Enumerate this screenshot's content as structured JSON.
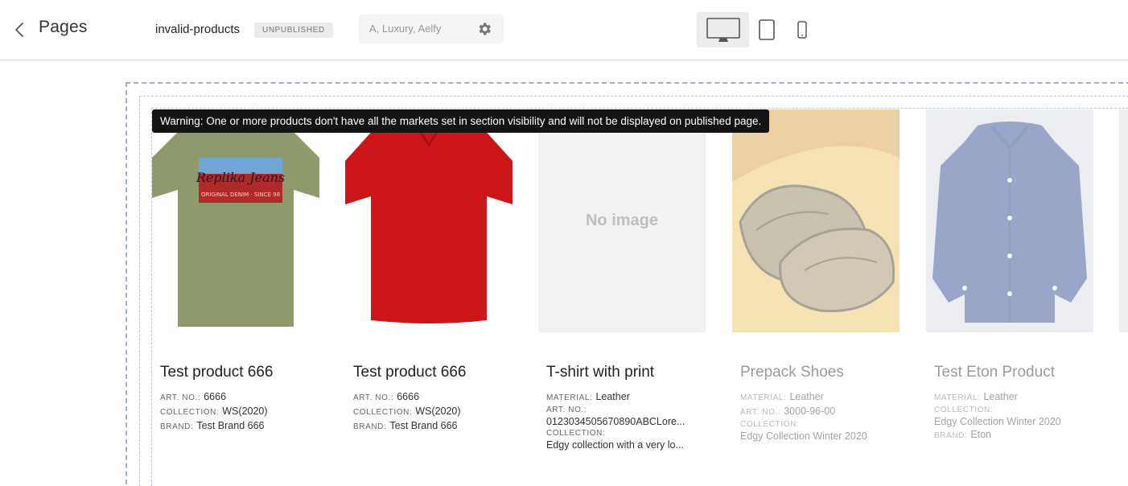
{
  "header": {
    "back_label": "Pages",
    "page_name": "invalid-products",
    "status_badge": "UNPUBLISHED",
    "markets_text": "A, Luxury, Aelfy"
  },
  "devices": [
    "desktop-icon",
    "tablet-icon",
    "mobile-icon"
  ],
  "selected_device": "desktop",
  "warning": "Warning: One or more products don't have all the markets set in section visibility and will not be displayed on published page.",
  "products": [
    {
      "name": "Test product 666",
      "image": "olive-tshirt",
      "art_label": "ART. NO.:",
      "art_value": "6666",
      "collection_label": "COLLECTION:",
      "collection_value": "WS(2020)",
      "brand_label": "BRAND:",
      "brand_value": "Test Brand 666"
    },
    {
      "name": "Test product 666",
      "image": "red-tshirt",
      "art_label": "ART. NO.:",
      "art_value": "6666",
      "collection_label": "COLLECTION:",
      "collection_value": "WS(2020)",
      "brand_label": "BRAND:",
      "brand_value": "Test Brand 666"
    },
    {
      "name": "T-shirt with print",
      "image_placeholder": "No image",
      "material_label": "MATERIAL:",
      "material_value": "Leather",
      "art_label": "ART. NO.:",
      "art_value": "0123034505670890ABCLore...",
      "collection_label": "COLLECTION:",
      "collection_value": "Edgy collection with a very lo..."
    },
    {
      "name": "Prepack Shoes",
      "image": "painted-shoes",
      "material_label": "MATERIAL:",
      "material_value": "Leather",
      "art_label": "ART. NO.:",
      "art_value": "3000-96-00",
      "collection_label": "COLLECTION:",
      "collection_value": "Edgy Collection Winter 2020"
    },
    {
      "name": "Test Eton Product",
      "image": "blue-shirt",
      "material_label": "MATERIAL:",
      "material_value": "Leather",
      "collection_label": "COLLECTION:",
      "collection_value": "Edgy Collection Winter 2020",
      "brand_label": "BRAND:",
      "brand_value": "Eton"
    }
  ],
  "colors": {
    "frame_dashed": "#9eb0c6",
    "warning_bg": "#141414",
    "tshirt_olive": "#8f9a6a",
    "tshirt_red": "#cc1518",
    "shirt_blue": "#1e3a8a"
  }
}
